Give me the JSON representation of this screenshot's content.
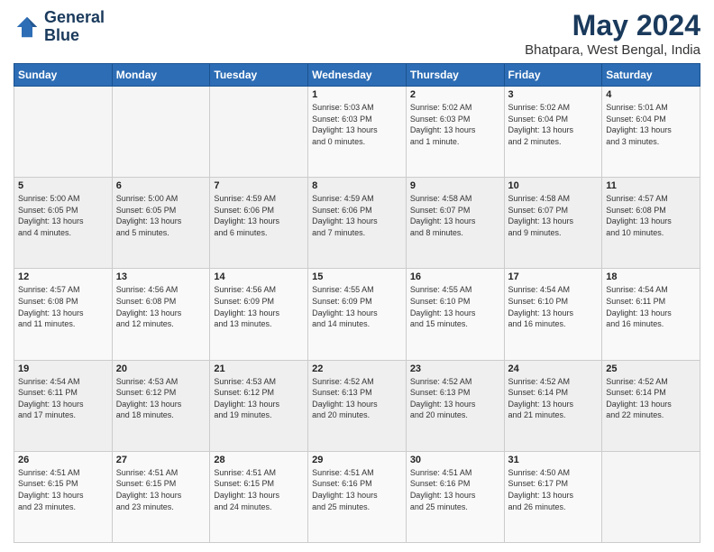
{
  "logo": {
    "line1": "General",
    "line2": "Blue"
  },
  "title": "May 2024",
  "subtitle": "Bhatpara, West Bengal, India",
  "days_of_week": [
    "Sunday",
    "Monday",
    "Tuesday",
    "Wednesday",
    "Thursday",
    "Friday",
    "Saturday"
  ],
  "weeks": [
    [
      {
        "day": "",
        "info": ""
      },
      {
        "day": "",
        "info": ""
      },
      {
        "day": "",
        "info": ""
      },
      {
        "day": "1",
        "info": "Sunrise: 5:03 AM\nSunset: 6:03 PM\nDaylight: 13 hours\nand 0 minutes."
      },
      {
        "day": "2",
        "info": "Sunrise: 5:02 AM\nSunset: 6:03 PM\nDaylight: 13 hours\nand 1 minute."
      },
      {
        "day": "3",
        "info": "Sunrise: 5:02 AM\nSunset: 6:04 PM\nDaylight: 13 hours\nand 2 minutes."
      },
      {
        "day": "4",
        "info": "Sunrise: 5:01 AM\nSunset: 6:04 PM\nDaylight: 13 hours\nand 3 minutes."
      }
    ],
    [
      {
        "day": "5",
        "info": "Sunrise: 5:00 AM\nSunset: 6:05 PM\nDaylight: 13 hours\nand 4 minutes."
      },
      {
        "day": "6",
        "info": "Sunrise: 5:00 AM\nSunset: 6:05 PM\nDaylight: 13 hours\nand 5 minutes."
      },
      {
        "day": "7",
        "info": "Sunrise: 4:59 AM\nSunset: 6:06 PM\nDaylight: 13 hours\nand 6 minutes."
      },
      {
        "day": "8",
        "info": "Sunrise: 4:59 AM\nSunset: 6:06 PM\nDaylight: 13 hours\nand 7 minutes."
      },
      {
        "day": "9",
        "info": "Sunrise: 4:58 AM\nSunset: 6:07 PM\nDaylight: 13 hours\nand 8 minutes."
      },
      {
        "day": "10",
        "info": "Sunrise: 4:58 AM\nSunset: 6:07 PM\nDaylight: 13 hours\nand 9 minutes."
      },
      {
        "day": "11",
        "info": "Sunrise: 4:57 AM\nSunset: 6:08 PM\nDaylight: 13 hours\nand 10 minutes."
      }
    ],
    [
      {
        "day": "12",
        "info": "Sunrise: 4:57 AM\nSunset: 6:08 PM\nDaylight: 13 hours\nand 11 minutes."
      },
      {
        "day": "13",
        "info": "Sunrise: 4:56 AM\nSunset: 6:08 PM\nDaylight: 13 hours\nand 12 minutes."
      },
      {
        "day": "14",
        "info": "Sunrise: 4:56 AM\nSunset: 6:09 PM\nDaylight: 13 hours\nand 13 minutes."
      },
      {
        "day": "15",
        "info": "Sunrise: 4:55 AM\nSunset: 6:09 PM\nDaylight: 13 hours\nand 14 minutes."
      },
      {
        "day": "16",
        "info": "Sunrise: 4:55 AM\nSunset: 6:10 PM\nDaylight: 13 hours\nand 15 minutes."
      },
      {
        "day": "17",
        "info": "Sunrise: 4:54 AM\nSunset: 6:10 PM\nDaylight: 13 hours\nand 16 minutes."
      },
      {
        "day": "18",
        "info": "Sunrise: 4:54 AM\nSunset: 6:11 PM\nDaylight: 13 hours\nand 16 minutes."
      }
    ],
    [
      {
        "day": "19",
        "info": "Sunrise: 4:54 AM\nSunset: 6:11 PM\nDaylight: 13 hours\nand 17 minutes."
      },
      {
        "day": "20",
        "info": "Sunrise: 4:53 AM\nSunset: 6:12 PM\nDaylight: 13 hours\nand 18 minutes."
      },
      {
        "day": "21",
        "info": "Sunrise: 4:53 AM\nSunset: 6:12 PM\nDaylight: 13 hours\nand 19 minutes."
      },
      {
        "day": "22",
        "info": "Sunrise: 4:52 AM\nSunset: 6:13 PM\nDaylight: 13 hours\nand 20 minutes."
      },
      {
        "day": "23",
        "info": "Sunrise: 4:52 AM\nSunset: 6:13 PM\nDaylight: 13 hours\nand 20 minutes."
      },
      {
        "day": "24",
        "info": "Sunrise: 4:52 AM\nSunset: 6:14 PM\nDaylight: 13 hours\nand 21 minutes."
      },
      {
        "day": "25",
        "info": "Sunrise: 4:52 AM\nSunset: 6:14 PM\nDaylight: 13 hours\nand 22 minutes."
      }
    ],
    [
      {
        "day": "26",
        "info": "Sunrise: 4:51 AM\nSunset: 6:15 PM\nDaylight: 13 hours\nand 23 minutes."
      },
      {
        "day": "27",
        "info": "Sunrise: 4:51 AM\nSunset: 6:15 PM\nDaylight: 13 hours\nand 23 minutes."
      },
      {
        "day": "28",
        "info": "Sunrise: 4:51 AM\nSunset: 6:15 PM\nDaylight: 13 hours\nand 24 minutes."
      },
      {
        "day": "29",
        "info": "Sunrise: 4:51 AM\nSunset: 6:16 PM\nDaylight: 13 hours\nand 25 minutes."
      },
      {
        "day": "30",
        "info": "Sunrise: 4:51 AM\nSunset: 6:16 PM\nDaylight: 13 hours\nand 25 minutes."
      },
      {
        "day": "31",
        "info": "Sunrise: 4:50 AM\nSunset: 6:17 PM\nDaylight: 13 hours\nand 26 minutes."
      },
      {
        "day": "",
        "info": ""
      }
    ]
  ]
}
